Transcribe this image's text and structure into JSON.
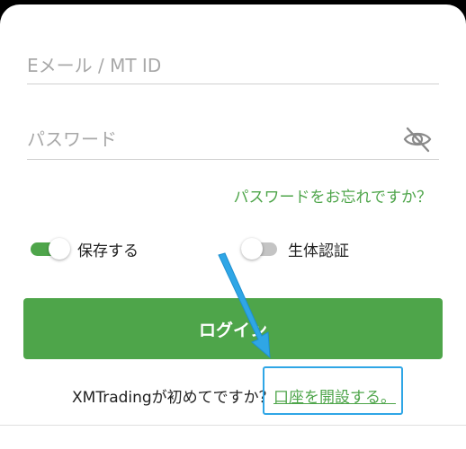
{
  "login_form": {
    "email_placeholder": "Eメール / MT ID",
    "email_value": "",
    "password_placeholder": "パスワード",
    "password_value": "",
    "password_visibility_icon": "eye-off-icon",
    "forgot_password_link": "パスワードをお忘れですか？",
    "remember_me": {
      "label": "保存する",
      "on": true
    },
    "biometric": {
      "label": "生体認証",
      "on": false
    },
    "login_button": "ログイン",
    "signup_prompt": "XMTradingが初めてですか？",
    "signup_link": "口座を開設する。"
  },
  "annotation": {
    "arrow_icon": "arrow-pointer-icon",
    "color": "#2fa6e6"
  },
  "colors": {
    "brand_green": "#4ea54a",
    "toggle_off": "#c4c4c4",
    "annotation_blue": "#2fa6e6"
  }
}
